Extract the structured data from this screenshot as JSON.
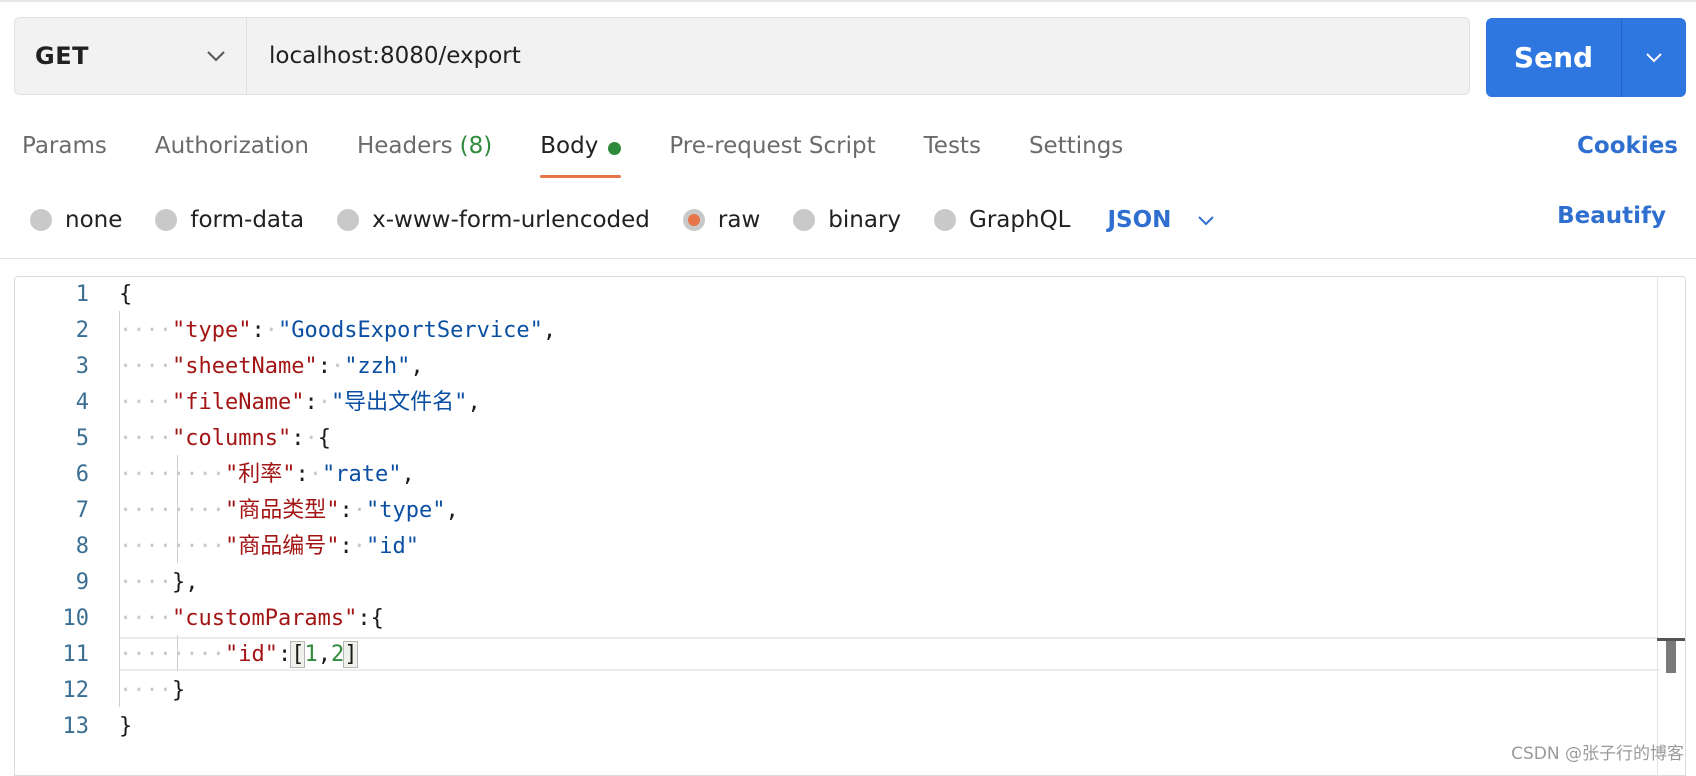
{
  "request": {
    "method": "GET",
    "url": "localhost:8080/export",
    "send_label": "Send"
  },
  "tabs": [
    {
      "label": "Params"
    },
    {
      "label": "Authorization"
    },
    {
      "label": "Headers",
      "count": "(8)"
    },
    {
      "label": "Body",
      "active": true
    },
    {
      "label": "Pre-request Script"
    },
    {
      "label": "Tests"
    },
    {
      "label": "Settings"
    }
  ],
  "cookies_label": "Cookies",
  "body_options": [
    {
      "label": "none",
      "checked": false
    },
    {
      "label": "form-data",
      "checked": false
    },
    {
      "label": "x-www-form-urlencoded",
      "checked": false
    },
    {
      "label": "raw",
      "checked": true
    },
    {
      "label": "binary",
      "checked": false
    },
    {
      "label": "GraphQL",
      "checked": false
    }
  ],
  "body_language": "JSON",
  "beautify_label": "Beautify",
  "editor": {
    "line_numbers": [
      "1",
      "2",
      "3",
      "4",
      "5",
      "6",
      "7",
      "8",
      "9",
      "10",
      "11",
      "12",
      "13"
    ],
    "lines": [
      "{",
      "    \"type\": \"GoodsExportService\",",
      "    \"sheetName\": \"zzh\",",
      "    \"fileName\": \"导出文件名\",",
      "    \"columns\": {",
      "        \"利率\": \"rate\",",
      "        \"商品类型\": \"type\",",
      "        \"商品编号\": \"id\"",
      "    },",
      "    \"customParams\":{",
      "        \"id\":[1,2]",
      "    }",
      "}"
    ],
    "tokens": {
      "l2_key": "\"type\"",
      "l2_val": "\"GoodsExportService\"",
      "l3_key": "\"sheetName\"",
      "l3_val": "\"zzh\"",
      "l4_key": "\"fileName\"",
      "l4_val": "\"导出文件名\"",
      "l5_key": "\"columns\"",
      "l6_key": "\"利率\"",
      "l6_val": "\"rate\"",
      "l7_key": "\"商品类型\"",
      "l7_val": "\"type\"",
      "l8_key": "\"商品编号\"",
      "l8_val": "\"id\"",
      "l10_key": "\"customParams\"",
      "l11_key": "\"id\"",
      "l11_n1": "1",
      "l11_n2": "2"
    }
  },
  "watermark": "CSDN @张子行的博客",
  "colors": {
    "send": "#2f77e0",
    "accent": "#e8744a",
    "link": "#2f6fcf",
    "json_key": "#a31515",
    "json_string": "#0b4fa3",
    "json_number": "#2f8a3c"
  }
}
